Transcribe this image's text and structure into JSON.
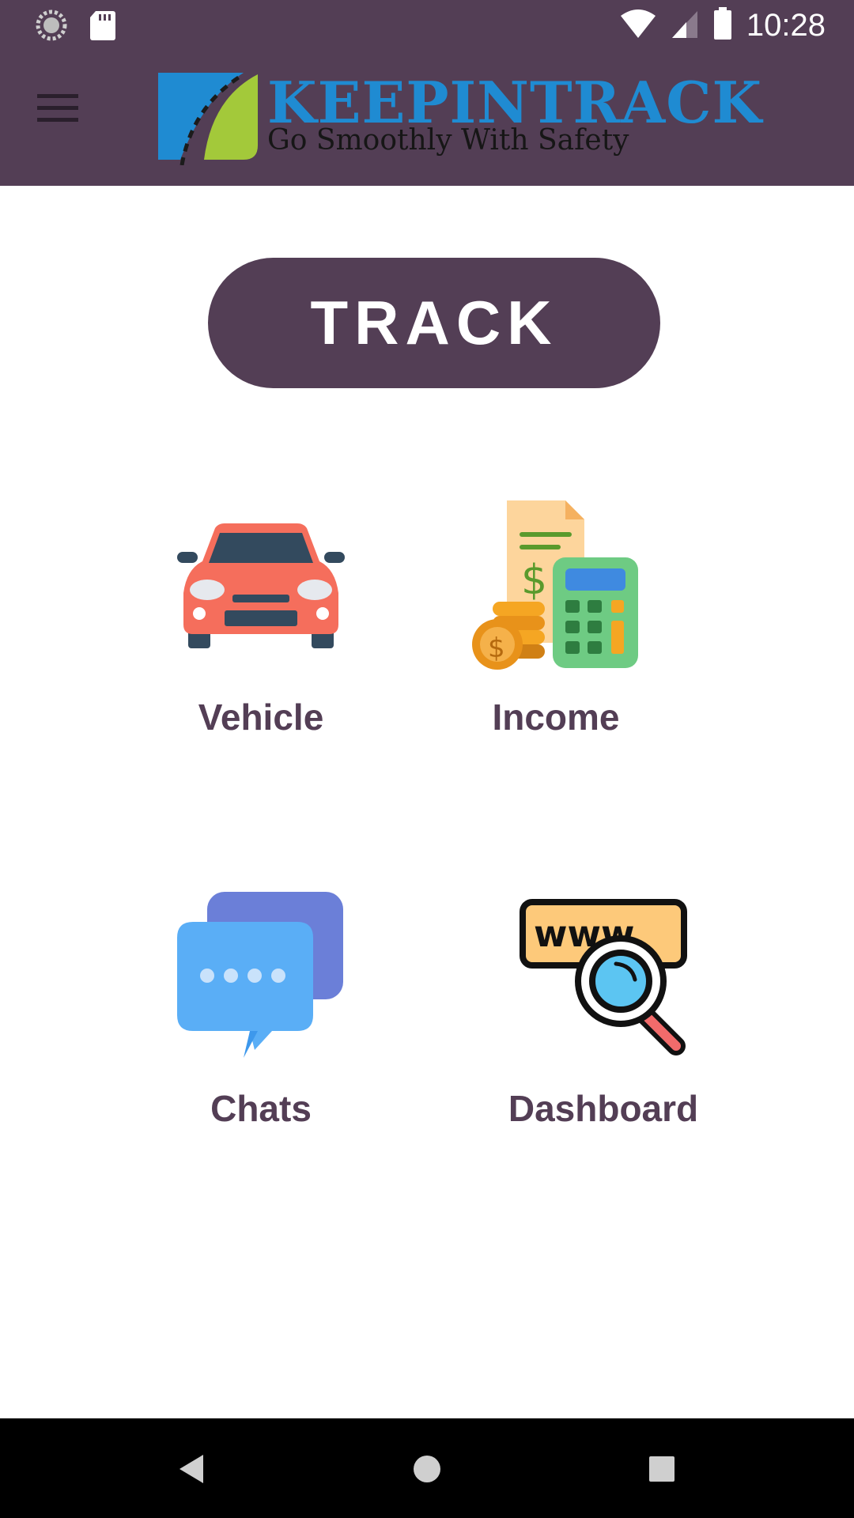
{
  "status_bar": {
    "time": "10:28",
    "icons": [
      "sync-icon",
      "sd-card-icon",
      "wifi-icon",
      "signal-icon",
      "battery-icon"
    ]
  },
  "app_bar": {
    "menu_icon": "hamburger-menu-icon",
    "brand_name": "KEEPINTRACK",
    "tagline": "Go Smoothly With Safety"
  },
  "track_button": {
    "label": "TRACK"
  },
  "tiles": [
    {
      "label": "Vehicle",
      "icon": "car-icon"
    },
    {
      "label": "Income",
      "icon": "income-calculator-icon"
    },
    {
      "label": "Chats",
      "icon": "chat-bubbles-icon"
    },
    {
      "label": "Dashboard",
      "icon": "www-search-icon"
    }
  ],
  "nav_bar": {
    "icons": [
      "back-icon",
      "home-icon",
      "recents-icon"
    ]
  },
  "colors": {
    "primary": "#533e55",
    "brand_blue": "#1f8bd2",
    "brand_green": "#a3c93a",
    "background": "#ffffff",
    "nav_bar": "#000000"
  }
}
